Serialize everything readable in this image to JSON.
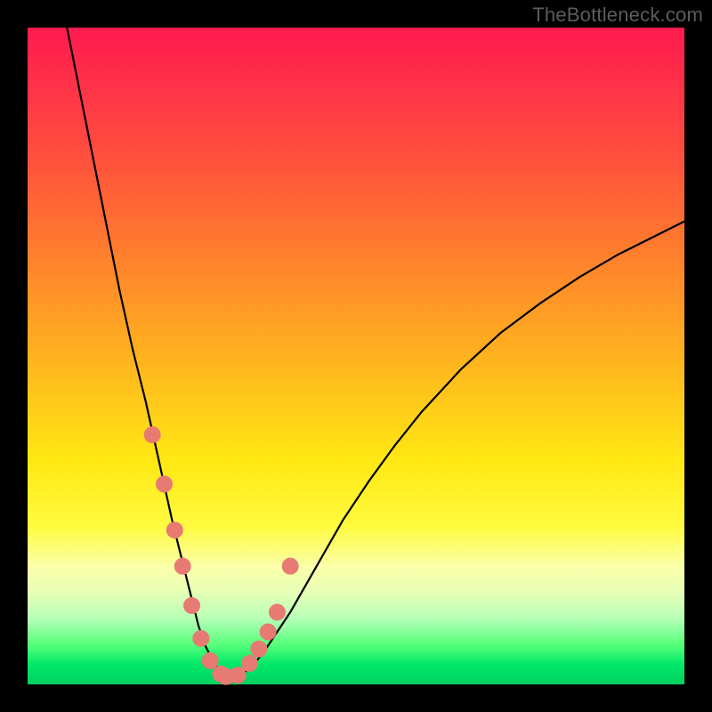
{
  "watermark": {
    "text": "TheBottleneck.com"
  },
  "chart_data": {
    "type": "line",
    "title": "",
    "xlabel": "",
    "ylabel": "",
    "xlim": [
      0,
      100
    ],
    "ylim": [
      0,
      100
    ],
    "grid": false,
    "legend": false,
    "series": [
      {
        "name": "curve",
        "x": [
          6,
          8,
          10,
          12,
          14,
          16,
          18,
          20,
          22,
          23,
          24,
          25,
          26,
          27,
          28,
          29,
          30,
          32,
          34,
          36,
          38,
          40,
          44,
          48,
          52,
          56,
          60,
          66,
          72,
          78,
          84,
          90,
          96,
          100
        ],
        "y": [
          100,
          90,
          80,
          70,
          60,
          51,
          43,
          34,
          25,
          21,
          17,
          13,
          9,
          6,
          4,
          2.2,
          1.2,
          1.2,
          2.5,
          5,
          8,
          11,
          18,
          25,
          31,
          36.5,
          41.5,
          48,
          53.5,
          58,
          62,
          65.5,
          68.5,
          70.5
        ]
      }
    ],
    "highlight_points": {
      "name": "sample-dots",
      "x": [
        19.0,
        20.8,
        22.4,
        23.6,
        25.0,
        26.4,
        27.8,
        29.4,
        30.2,
        32.0,
        33.8,
        35.2,
        36.6,
        38.0,
        40.0
      ],
      "y": [
        38.0,
        30.5,
        23.5,
        18.0,
        12.0,
        7.0,
        3.6,
        1.6,
        1.2,
        1.4,
        3.2,
        5.4,
        8.0,
        11.0,
        18.0
      ]
    },
    "background_gradient": {
      "top": "#ff1a4f",
      "upper_mid": "#ffb21f",
      "mid": "#ffe813",
      "lower_mid": "#b6ffb6",
      "bottom": "#00d060"
    }
  }
}
